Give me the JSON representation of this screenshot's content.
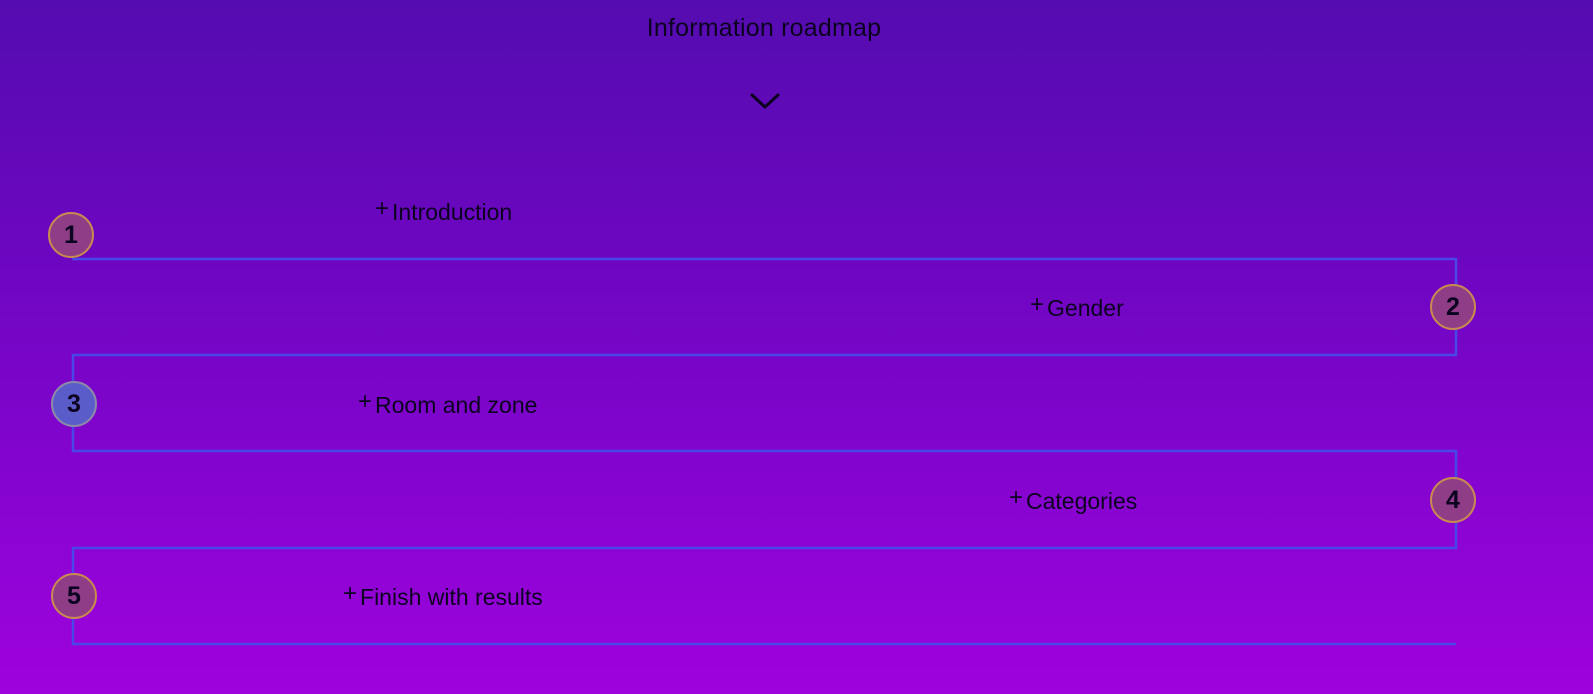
{
  "header": {
    "title": "Information roadmap"
  },
  "colors": {
    "path_line": "#4a47e8",
    "circle_fill": "#8f3d86",
    "circle_border": "#c98a52",
    "active_circle_fill": "#5a5cc9"
  },
  "steps": [
    {
      "number": "1",
      "label": "Introduction",
      "active": false
    },
    {
      "number": "2",
      "label": "Gender",
      "active": false
    },
    {
      "number": "3",
      "label": "Room and zone",
      "active": true
    },
    {
      "number": "4",
      "label": "Categories",
      "active": false
    },
    {
      "number": "5",
      "label": "Finish with results",
      "active": false
    }
  ]
}
